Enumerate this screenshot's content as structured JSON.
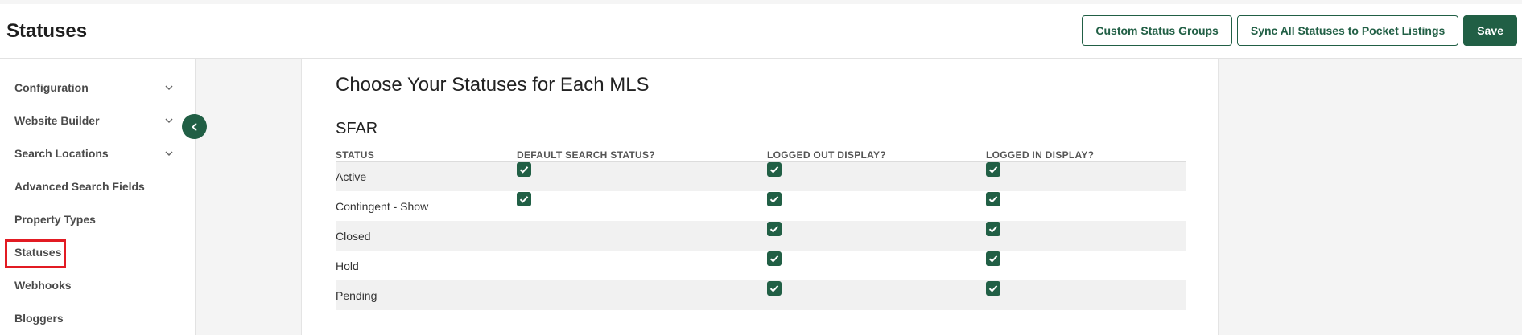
{
  "header": {
    "title": "Statuses",
    "buttons": {
      "custom_groups": "Custom Status Groups",
      "sync": "Sync All Statuses to Pocket Listings",
      "save": "Save"
    }
  },
  "sidebar": {
    "items": [
      {
        "label": "Configuration",
        "has_chevron": true
      },
      {
        "label": "Website Builder",
        "has_chevron": true
      },
      {
        "label": "Search Locations",
        "has_chevron": true
      },
      {
        "label": "Advanced Search Fields",
        "has_chevron": false
      },
      {
        "label": "Property Types",
        "has_chevron": false
      },
      {
        "label": "Statuses",
        "has_chevron": false,
        "selected": true
      },
      {
        "label": "Webhooks",
        "has_chevron": false
      },
      {
        "label": "Bloggers",
        "has_chevron": false
      }
    ],
    "collapse_icon": "chevron-left-icon"
  },
  "main": {
    "title": "Choose Your Statuses for Each MLS",
    "mls": {
      "name": "SFAR",
      "columns": [
        "STATUS",
        "DEFAULT SEARCH STATUS?",
        "LOGGED OUT DISPLAY?",
        "LOGGED IN DISPLAY?"
      ],
      "rows": [
        {
          "status": "Active",
          "default_search": true,
          "logged_out": true,
          "logged_in": true
        },
        {
          "status": "Contingent - Show",
          "default_search": true,
          "logged_out": true,
          "logged_in": true
        },
        {
          "status": "Closed",
          "default_search": false,
          "logged_out": true,
          "logged_in": true
        },
        {
          "status": "Hold",
          "default_search": false,
          "logged_out": true,
          "logged_in": true
        },
        {
          "status": "Pending",
          "default_search": false,
          "logged_out": true,
          "logged_in": true
        }
      ]
    }
  },
  "colors": {
    "accent": "#215f45",
    "selection_outline": "#e21b23",
    "row_stripe": "#f1f1f1"
  }
}
